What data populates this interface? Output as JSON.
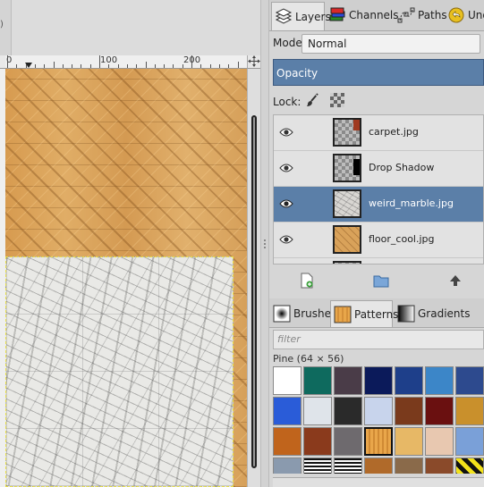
{
  "ruler": {
    "labels": [
      "0",
      "100",
      "200"
    ]
  },
  "dock_top": {
    "tabs": [
      {
        "label": "Layers",
        "icon": "layers-icon",
        "active": true
      },
      {
        "label": "Channels",
        "icon": "channels-icon",
        "active": false
      },
      {
        "label": "Paths",
        "icon": "paths-icon",
        "active": false
      },
      {
        "label": "Und",
        "icon": "undo-history-icon",
        "active": false
      }
    ]
  },
  "layers_panel": {
    "mode_label": "Mode:",
    "mode_value": "Normal",
    "opacity_label": "Opacity",
    "lock_label": "Lock:",
    "layers": [
      {
        "name": "carpet.jpg",
        "visible": true,
        "selected": false
      },
      {
        "name": "Drop Shadow",
        "visible": true,
        "selected": false
      },
      {
        "name": "weird_marble.jpg",
        "visible": true,
        "selected": true
      },
      {
        "name": "floor_cool.jpg",
        "visible": true,
        "selected": false
      }
    ],
    "buttons": [
      "new-layer-icon",
      "new-layer-group-icon",
      "raise-layer-icon"
    ]
  },
  "dock_bottom": {
    "tabs": [
      {
        "label": "Brushes",
        "icon": "brushes-icon",
        "active": false
      },
      {
        "label": "Patterns",
        "icon": "patterns-icon",
        "active": true
      },
      {
        "label": "Gradients",
        "icon": "gradients-icon",
        "active": false
      }
    ]
  },
  "patterns_panel": {
    "filter_placeholder": "filter",
    "selected_pattern": "Pine (64 × 56)",
    "colors": {
      "accent": "#5b7fa8",
      "canvas_wood": "#d9a25a",
      "marble": "#e9e9e6"
    },
    "swatches": [
      [
        "#ffffff",
        "#0e6a5e",
        "#4a3c48",
        "#0b1a5a",
        "#1e3f8a",
        "#3c86c8",
        "#2d4a8e"
      ],
      [
        "#2a5cd8",
        "#dfe4ea",
        "#2a2a2a",
        "#c8d4ec",
        "#7a3a1c",
        "#6a1010",
        "#c9902c"
      ],
      [
        "#c0641c",
        "#8a3a1c",
        "#6e6a6e",
        "#e9a64a",
        "#e7b866",
        "#e8c8b0",
        "#7aa0d8"
      ],
      [
        "#8a9aae",
        "#111111",
        "#101010",
        "#b06a2a",
        "#8a6a4a",
        "#8a4a2a",
        "#f2e21a"
      ]
    ]
  }
}
